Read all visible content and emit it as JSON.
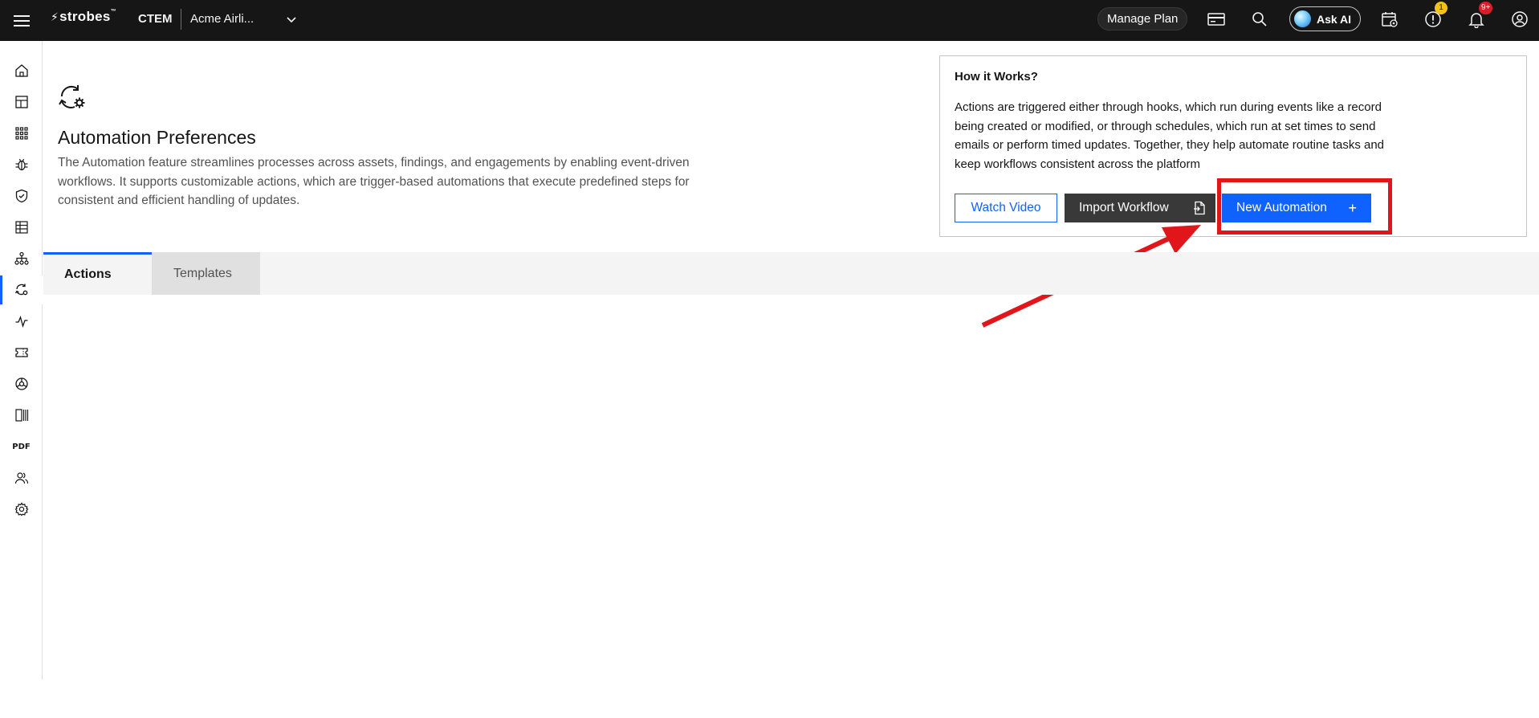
{
  "header": {
    "logo_text": "strobes",
    "product": "CTEM",
    "org_selector": "Acme Airli...",
    "manage_plan_label": "Manage Plan",
    "ask_ai_label": "Ask AI",
    "alerts_badge": "1",
    "notifications_badge": "9+",
    "icons": [
      "menu-icon",
      "billing-card-icon",
      "search-icon",
      "ask-ai-orb-icon",
      "calendar-settings-icon",
      "alert-icon",
      "notification-bell-icon",
      "user-avatar-icon"
    ]
  },
  "sidebar": {
    "items": [
      {
        "icon": "home-icon"
      },
      {
        "icon": "dashboard-icon"
      },
      {
        "icon": "apps-grid-icon"
      },
      {
        "icon": "bug-icon"
      },
      {
        "icon": "shield-check-icon"
      },
      {
        "icon": "table-icon"
      },
      {
        "icon": "hierarchy-icon"
      },
      {
        "icon": "automation-icon",
        "active": true
      },
      {
        "icon": "activity-icon"
      },
      {
        "icon": "ticket-icon"
      },
      {
        "icon": "integration-icon"
      },
      {
        "icon": "columns-icon"
      },
      {
        "icon": "pdf-icon",
        "text": "PDF"
      },
      {
        "icon": "users-icon"
      },
      {
        "icon": "settings-icon"
      }
    ]
  },
  "page": {
    "title": "Automation Preferences",
    "description": "The Automation feature streamlines processes across assets, findings, and engagements by enabling event-driven workflows. It supports customizable actions, which are trigger-based automations that execute predefined steps for consistent and efficient handling of updates."
  },
  "how_it_works": {
    "title": "How it Works?",
    "body": "Actions are triggered either through hooks, which run during events like a record being created or modified, or through schedules, which run at set times to send emails or perform timed updates. Together, they help automate routine tasks and keep workflows consistent across the platform",
    "watch_video_label": "Watch Video",
    "import_workflow_label": "Import Workflow",
    "new_automation_label": "New Automation",
    "new_automation_icon": "+"
  },
  "tabs": [
    {
      "label": "Actions",
      "selected": true
    },
    {
      "label": "Templates",
      "selected": false
    }
  ],
  "colors": {
    "accent": "#0f62fe",
    "header_bg": "#161616",
    "annotation": "#e0161b"
  }
}
